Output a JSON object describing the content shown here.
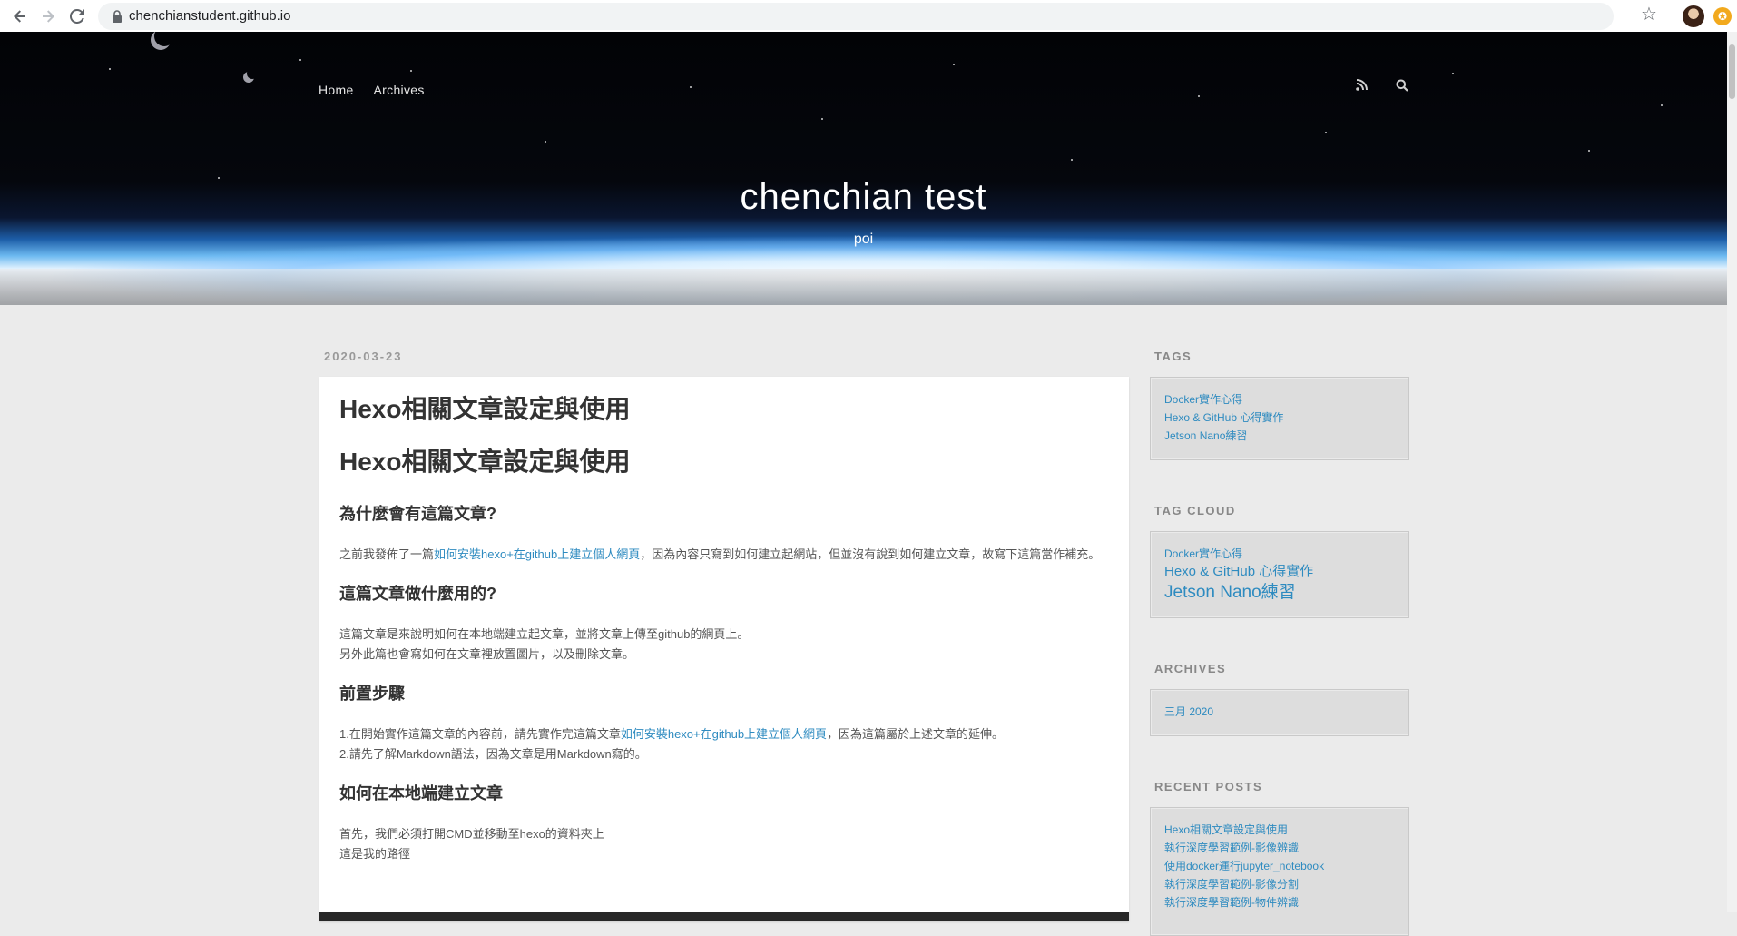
{
  "browser": {
    "url": "chenchianstudent.github.io"
  },
  "site": {
    "nav": [
      "Home",
      "Archives"
    ],
    "title": "chenchian test",
    "subtitle": "poi"
  },
  "post": {
    "date": "2020-03-23",
    "title": "Hexo相關文章設定與使用",
    "heading1": "Hexo相關文章設定與使用",
    "sections": [
      {
        "heading": "為什麼會有這篇文章?",
        "lines": [
          [
            {
              "text": "之前我發佈了一篇"
            },
            {
              "text": "如何安裝hexo+在github上建立個人網頁",
              "link": true
            },
            {
              "text": "，因為內容只寫到如何建立起網站，但並沒有說到如何建立文章，故寫下這篇當作補充。"
            }
          ]
        ]
      },
      {
        "heading": "這篇文章做什麼用的?",
        "lines": [
          [
            {
              "text": "這篇文章是來說明如何在本地端建立起文章，並將文章上傳至github的網頁上。"
            }
          ],
          [
            {
              "text": "另外此篇也會寫如何在文章裡放置圖片，以及刪除文章。"
            }
          ]
        ]
      },
      {
        "heading": "前置步驟",
        "lines": [
          [
            {
              "text": "1.在開始實作這篇文章的內容前，請先實作完這篇文章"
            },
            {
              "text": "如何安裝hexo+在github上建立個人網頁",
              "link": true
            },
            {
              "text": "，因為這篇屬於上述文章的延伸。"
            }
          ],
          [
            {
              "text": "2.請先了解Markdown語法，因為文章是用Markdown寫的。"
            }
          ]
        ]
      },
      {
        "heading": "如何在本地端建立文章",
        "lines": [
          [
            {
              "text": "首先，我們必須打開CMD並移動至hexo的資料夾上"
            }
          ],
          [
            {
              "text": "這是我的路徑"
            }
          ]
        ]
      }
    ]
  },
  "sidebar": {
    "tags": {
      "title": "TAGS",
      "items": [
        "Docker實作心得",
        "Hexo & GitHub 心得實作",
        "Jetson Nano練習"
      ]
    },
    "tag_cloud": {
      "title": "TAG CLOUD",
      "items": [
        "Docker實作心得",
        "Hexo & GitHub 心得實作",
        "Jetson Nano練習"
      ]
    },
    "archives": {
      "title": "ARCHIVES",
      "items": [
        "三月 2020"
      ]
    },
    "recent_posts": {
      "title": "RECENT POSTS",
      "items": [
        "Hexo相關文章設定與使用",
        "執行深度學習範例-影像辨識",
        "使用docker運行jupyter_notebook",
        "執行深度學習範例-影像分割",
        "執行深度學習範例-物件辨識"
      ]
    }
  }
}
